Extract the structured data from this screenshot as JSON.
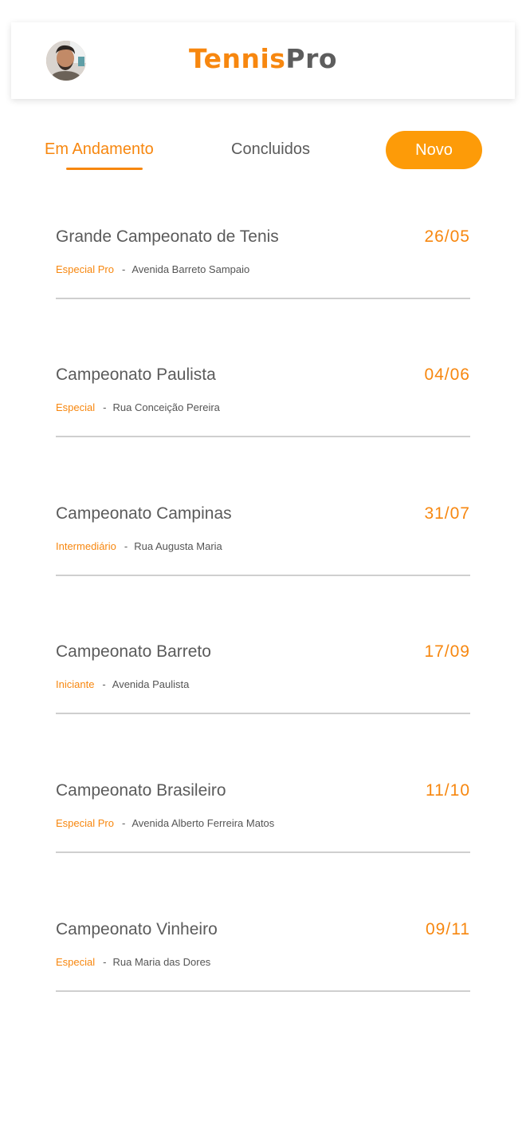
{
  "brand": {
    "logo_part1": "Tennis",
    "logo_part2": "Pro",
    "accent_color": "#f7870f",
    "button_color": "#fd9b08"
  },
  "header": {
    "avatar_icon": "user-avatar"
  },
  "tabs": {
    "active_label": "Em Andamento",
    "inactive_label": "Concluidos",
    "new_button_label": "Novo"
  },
  "events": [
    {
      "title": "Grande Campeonato de Tenis",
      "date": "26/05",
      "level": "Especial Pro",
      "separator": "-",
      "address": "Avenida Barreto Sampaio"
    },
    {
      "title": "Campeonato Paulista",
      "date": "04/06",
      "level": "Especial",
      "separator": "-",
      "address": "Rua Conceição Pereira"
    },
    {
      "title": "Campeonato Campinas",
      "date": "31/07",
      "level": "Intermediário",
      "separator": "-",
      "address": "Rua Augusta Maria"
    },
    {
      "title": "Campeonato Barreto",
      "date": "17/09",
      "level": "Iniciante",
      "separator": "-",
      "address": "Avenida Paulista"
    },
    {
      "title": "Campeonato Brasileiro",
      "date": "11/10",
      "level": "Especial Pro",
      "separator": "-",
      "address": "Avenida Alberto Ferreira Matos"
    },
    {
      "title": "Campeonato Vinheiro",
      "date": "09/11",
      "level": "Especial",
      "separator": "-",
      "address": "Rua Maria das Dores"
    }
  ]
}
